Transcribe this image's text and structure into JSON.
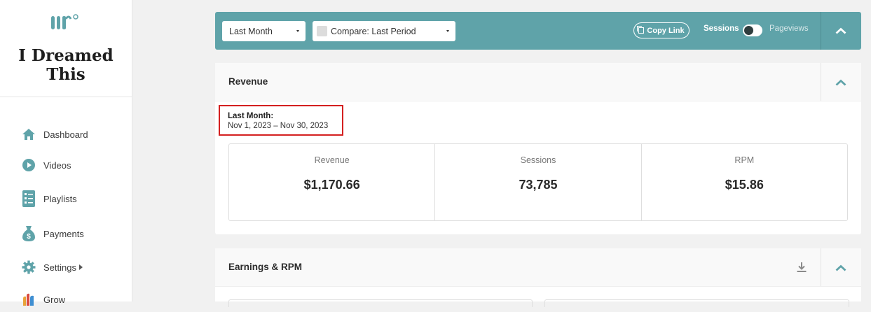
{
  "brand": {
    "site_title": "I Dreamed This",
    "logo_icon": "m-logo-icon"
  },
  "sidebar": {
    "items": [
      {
        "label": "Dashboard",
        "icon": "home-icon"
      },
      {
        "label": "Videos",
        "icon": "play-circle-icon"
      },
      {
        "label": "Playlists",
        "icon": "checklist-icon"
      },
      {
        "label": "Payments",
        "icon": "money-bag-icon"
      },
      {
        "label": "Settings",
        "icon": "gear-icon"
      },
      {
        "label": "Grow",
        "icon": "grow-icon"
      }
    ]
  },
  "toolbar": {
    "period_select": "Last Month",
    "compare_select": "Compare: Last Period",
    "copy_link": "Copy Link",
    "toggle_left": "Sessions",
    "toggle_right": "Pageviews",
    "accent": "#5fa3a9"
  },
  "revenue_card": {
    "title": "Revenue",
    "range_title": "Last Month:",
    "range_dates": "Nov 1, 2023 – Nov 30, 2023",
    "metrics": [
      {
        "label": "Revenue",
        "value": "$1,170.66"
      },
      {
        "label": "Sessions",
        "value": "73,785"
      },
      {
        "label": "RPM",
        "value": "$15.86"
      }
    ]
  },
  "earnings_card": {
    "title": "Earnings & RPM"
  },
  "colors": {
    "teal": "#5fa3a9",
    "highlight_red": "#d42020"
  }
}
